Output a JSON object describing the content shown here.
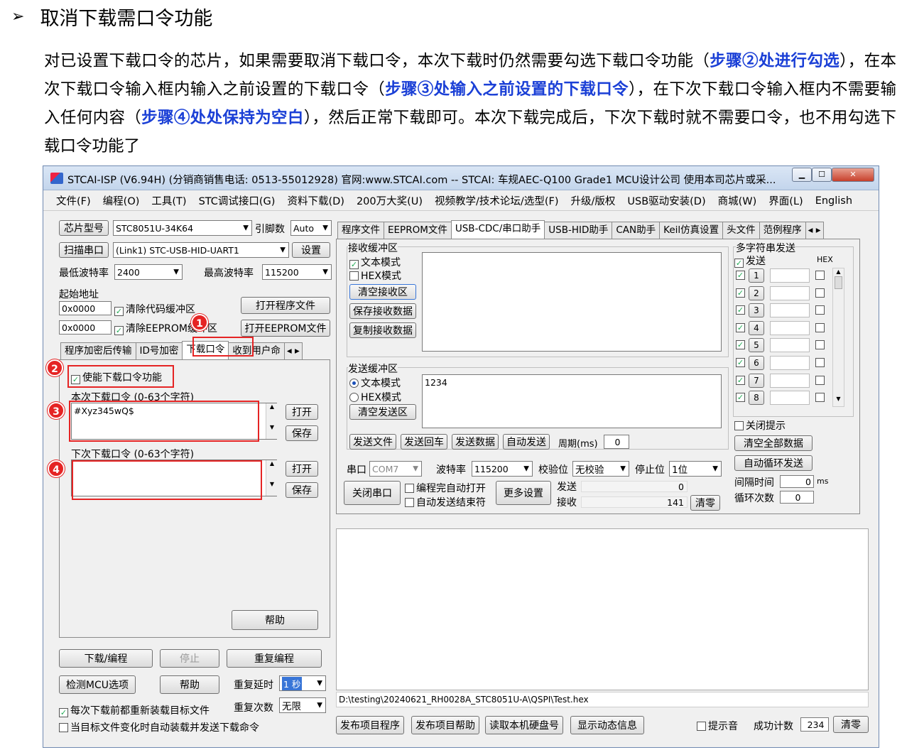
{
  "doc": {
    "title": "取消下载需口令功能",
    "para": [
      {
        "t": "对已设置下载口令的芯片，如果需要取消下载口令，本次下载时仍然需要勾选下载口令功能（",
        "h": false
      },
      {
        "t": "步骤②处进行勾选",
        "h": true
      },
      {
        "t": "），在本次下载口令输入框内输入之前设置的下载口令（",
        "h": false
      },
      {
        "t": "步骤③处输入之前设置的下载口令",
        "h": true
      },
      {
        "t": "），在下次下载口令输入框内不需要输入任何内容（",
        "h": false
      },
      {
        "t": "步骤④处处保持为空白",
        "h": true
      },
      {
        "t": "），然后正常下载即可。本次下载完成后，下次下载时就不需要口令，也不用勾选下载口令功能了",
        "h": false
      }
    ]
  },
  "window": {
    "title": "STCAI-ISP (V6.94H) (分销商销售电话: 0513-55012928) 官网:www.STCAI.com  -- STCAI: 车规AEC-Q100 Grade1 MCU设计公司 使用本司芯片或采...",
    "menu": [
      "文件(F)",
      "编程(O)",
      "工具(T)",
      "STC调试接口(G)",
      "资料下载(D)",
      "200万大奖(U)",
      "视频教学/技术论坛/选型(F)",
      "升级/版权",
      "USB驱动安装(D)",
      "商城(W)",
      "界面(L)",
      "English"
    ]
  },
  "left": {
    "chip_label": "芯片型号",
    "chip_value": "STC8051U-34K64",
    "pins_label": "引脚数",
    "pins_value": "Auto",
    "scan_label": "扫描串口",
    "port_value": "(Link1) STC-USB-HID-UART1",
    "settings_label": "设置",
    "min_baud_label": "最低波特率",
    "min_baud": "2400",
    "max_baud_label": "最高波特率",
    "max_baud": "115200",
    "start_addr_label": "起始地址",
    "addr1": "0x0000",
    "clear_code": "清除代码缓冲区",
    "open_prog": "打开程序文件",
    "addr2": "0x0000",
    "clear_eeprom": "清除EEPROM缓冲区",
    "open_eeprom": "打开EEPROM文件",
    "tabs": [
      "程序加密后传输",
      "ID号加密",
      "下载口令",
      "收到用户命"
    ],
    "enable_pwd": "使能下载口令功能",
    "cur_pwd_label": "本次下载口令 (0-63个字符)",
    "cur_pwd": "#Xyz345wQ$",
    "next_pwd_label": "下次下载口令 (0-63个字符)",
    "next_pwd": "",
    "open": "打开",
    "save": "保存",
    "help": "帮助",
    "download": "下载/编程",
    "stop": "停止",
    "reprog": "重复编程",
    "check_mcu": "检测MCU选项",
    "help2": "帮助",
    "retry_delay_label": "重复延时",
    "retry_delay": "1 秒",
    "reload": "每次下载前都重新装载目标文件",
    "retry_count_label": "重复次数",
    "retry_count": "无限",
    "auto_load": "当目标文件变化时自动装载并发送下载命令",
    "markers": [
      "1",
      "2",
      "3",
      "4"
    ]
  },
  "right": {
    "tabs": [
      "程序文件",
      "EEPROM文件",
      "USB-CDC/串口助手",
      "USB-HID助手",
      "CAN助手",
      "Keil仿真设置",
      "头文件",
      "范例程序"
    ],
    "recv_title": "接收缓冲区",
    "text_mode": "文本模式",
    "hex_mode": "HEX模式",
    "clear_recv": "清空接收区",
    "save_recv": "保存接收数据",
    "copy_recv": "复制接收数据",
    "send_title": "发送缓冲区",
    "clear_send": "清空发送区",
    "send_text": "1234",
    "send_file": "发送文件",
    "send_cr": "发送回车",
    "send_data": "发送数据",
    "auto_send": "自动发送",
    "period_label": "周期(ms)",
    "period": "0",
    "port_label": "串口",
    "port": "COM7",
    "baud_label": "波特率",
    "baud": "115200",
    "parity_label": "校验位",
    "parity": "无校验",
    "stop_label": "停止位",
    "stopbits": "1位",
    "close_port": "关闭串口",
    "auto_open": "编程完自动打开",
    "auto_end": "自动发送结束符",
    "more": "更多设置",
    "send_lbl": "发送",
    "send_count": "0",
    "recv_lbl": "接收",
    "recv_count": "141",
    "clear_cnt": "清零",
    "multi_title": "多字符串发送",
    "send_hdr": "发送",
    "hex_hdr": "HEX",
    "rows": [
      "1",
      "2",
      "3",
      "4",
      "5",
      "6",
      "7",
      "8"
    ],
    "close_tip": "关闭提示",
    "clear_all": "清空全部数据",
    "auto_loop": "自动循环发送",
    "interval_label": "间隔时间",
    "interval": "0",
    "interval_unit": "ms",
    "loop_label": "循环次数",
    "loop": "0",
    "path": "D:\\testing\\20240621_RH0028A_STC8051U-A\\QSPI\\Test.hex",
    "pub_prog": "发布项目程序",
    "pub_help": "发布项目帮助",
    "read_disk": "读取本机硬盘号",
    "show_dyn": "显示动态信息",
    "sound": "提示音",
    "success_label": "成功计数",
    "success": "234",
    "clear2": "清零"
  }
}
